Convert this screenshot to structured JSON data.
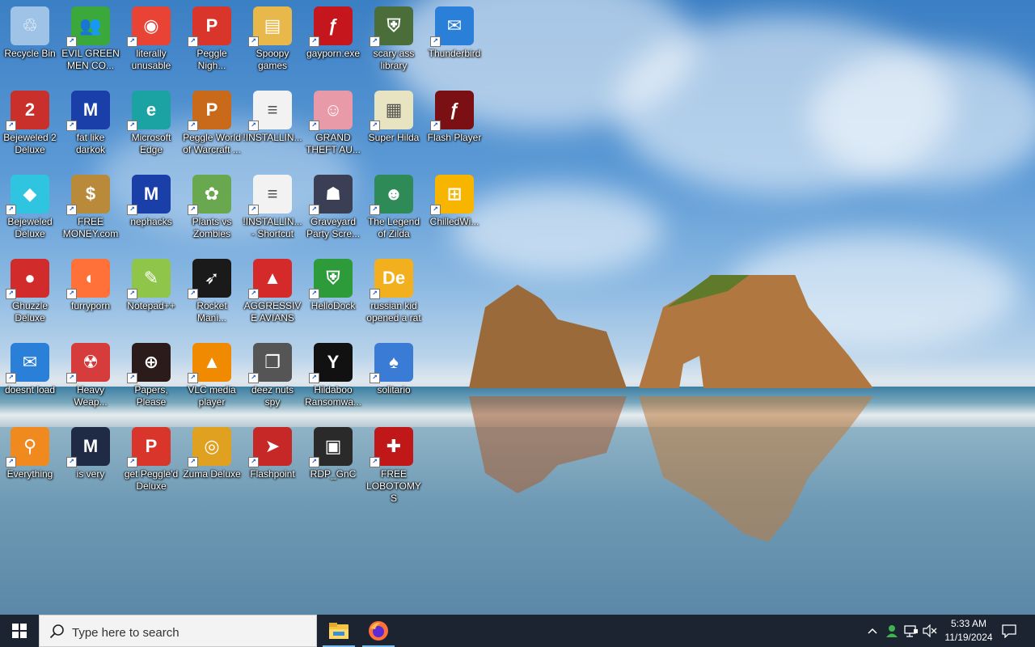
{
  "desktop": {
    "icons": [
      {
        "label": "Recycle Bin",
        "icon": "recycle-bin-icon",
        "color": "#9fc3e6",
        "glyph": "♲"
      },
      {
        "label": "EVIL GREEN MEN CO...",
        "icon": "green-people-icon",
        "color": "#3aa83a",
        "glyph": "👥"
      },
      {
        "label": "literally unusable",
        "icon": "chrome-icon",
        "color": "#e94335",
        "glyph": "◉"
      },
      {
        "label": "Peggle Nigh...",
        "icon": "peggle-icon",
        "color": "#d9352a",
        "glyph": "P"
      },
      {
        "label": "Spoopy games",
        "icon": "folder-icon",
        "color": "#e8b84a",
        "glyph": "▤"
      },
      {
        "label": "gayporn.exe",
        "icon": "flash-icon",
        "color": "#c4161c",
        "glyph": "ƒ"
      },
      {
        "label": "scary ass library",
        "icon": "library-shield-icon",
        "color": "#4a6d3a",
        "glyph": "⛨"
      },
      {
        "label": "Thunderbird",
        "icon": "thunderbird-icon",
        "color": "#2a7fd9",
        "glyph": "✉"
      },
      {
        "label": "Bejeweled 2 Deluxe",
        "icon": "bejeweled2-icon",
        "color": "#c9302c",
        "glyph": "2"
      },
      {
        "label": "fat like darkok",
        "icon": "mpi-icon",
        "color": "#1b3fa8",
        "glyph": "M"
      },
      {
        "label": "Microsoft Edge",
        "icon": "edge-icon",
        "color": "#1ba3a3",
        "glyph": "e"
      },
      {
        "label": "Peggle World of Warcraft ...",
        "icon": "peggle-wow-icon",
        "color": "#c96a1a",
        "glyph": "P"
      },
      {
        "label": "!INSTALLIN...",
        "icon": "text-file-icon",
        "color": "#f2f2f2",
        "glyph": "≡"
      },
      {
        "label": "GRAND THEFT AU...",
        "icon": "anime-girl-icon",
        "color": "#e89aa8",
        "glyph": "☺"
      },
      {
        "label": "Super Hilda",
        "icon": "pixel-hilda-icon",
        "color": "#e8e3c0",
        "glyph": "▦"
      },
      {
        "label": "Flash Player",
        "icon": "flash-player-icon",
        "color": "#7a1013",
        "glyph": "ƒ"
      },
      {
        "label": "Bejeweled Deluxe",
        "icon": "gem-icon",
        "color": "#2fc4e0",
        "glyph": "◆"
      },
      {
        "label": "FREE MONEY.com",
        "icon": "money-bag-icon",
        "color": "#b98a3a",
        "glyph": "$"
      },
      {
        "label": "nephacks",
        "icon": "mpi-icon",
        "color": "#1b3fa8",
        "glyph": "M"
      },
      {
        "label": "Plants vs Zombies",
        "icon": "plants-vs-zombies-icon",
        "color": "#6aa84f",
        "glyph": "✿"
      },
      {
        "label": "!INSTALLIN... - Shortcut",
        "icon": "text-file-icon",
        "color": "#f2f2f2",
        "glyph": "≡"
      },
      {
        "label": "Graveyard Party Scre...",
        "icon": "graveyard-icon",
        "color": "#3a3f55",
        "glyph": "☗"
      },
      {
        "label": "The Legend of Zilda",
        "icon": "zilda-icon",
        "color": "#2e8b57",
        "glyph": "☻"
      },
      {
        "label": "ChilledWi...",
        "icon": "windows-flag-icon",
        "color": "#f7b500",
        "glyph": "⊞"
      },
      {
        "label": "Ghuzzle Deluxe",
        "icon": "red-creature-icon",
        "color": "#d12b2b",
        "glyph": "●"
      },
      {
        "label": "furryporn",
        "icon": "firefox-icon",
        "color": "#ff7139",
        "glyph": "◐"
      },
      {
        "label": "Notepad++",
        "icon": "notepad-plus-icon",
        "color": "#8fc64a",
        "glyph": "✎"
      },
      {
        "label": "Rocket Mani...",
        "icon": "rocket-icon",
        "color": "#1a1a1a",
        "glyph": "➶"
      },
      {
        "label": "AGGRESSIVE AVIANS",
        "icon": "angry-bird-icon",
        "color": "#d42a2a",
        "glyph": "▲"
      },
      {
        "label": "HelloDock",
        "icon": "windows-shield-icon",
        "color": "#2e9b3b",
        "glyph": "⛨"
      },
      {
        "label": "russian kid opened a rat",
        "icon": "de-icon",
        "color": "#f2b01e",
        "glyph": "De"
      },
      {
        "label": "",
        "icon": "",
        "color": "",
        "glyph": ""
      },
      {
        "label": "doesnt load",
        "icon": "thunderbird-icon",
        "color": "#2a7fd9",
        "glyph": "✉"
      },
      {
        "label": "Heavy Weap...",
        "icon": "radiation-icon",
        "color": "#d63c3c",
        "glyph": "☢"
      },
      {
        "label": "Papers, Please",
        "icon": "papers-please-icon",
        "color": "#2b1b1b",
        "glyph": "⊕"
      },
      {
        "label": "VLC media player",
        "icon": "vlc-icon",
        "color": "#f08a00",
        "glyph": "▲"
      },
      {
        "label": "deez nuts spy",
        "icon": "windows-stack-icon",
        "color": "#555555",
        "glyph": "❐"
      },
      {
        "label": "Hildaboo Ransomwa...",
        "icon": "yashma-icon",
        "color": "#111111",
        "glyph": "Y"
      },
      {
        "label": "solitario",
        "icon": "card-icon",
        "color": "#3a7bd5",
        "glyph": "♠"
      },
      {
        "label": "",
        "icon": "",
        "color": "",
        "glyph": ""
      },
      {
        "label": "Everything",
        "icon": "magnifier-icon",
        "color": "#f08a1e",
        "glyph": "⚲"
      },
      {
        "label": "is very",
        "icon": "mpi-shield-icon",
        "color": "#1f2a44",
        "glyph": "M"
      },
      {
        "label": "get Peggle'd Deluxe",
        "icon": "peggle-icon",
        "color": "#d9352a",
        "glyph": "P"
      },
      {
        "label": "Zuma Deluxe",
        "icon": "zuma-icon",
        "color": "#e0a020",
        "glyph": "◎"
      },
      {
        "label": "Flashpoint",
        "icon": "flashpoint-icon",
        "color": "#c62828",
        "glyph": "➤"
      },
      {
        "label": "RDP_GnC",
        "icon": "rdp-icon",
        "color": "#2a2a2a",
        "glyph": "▣"
      },
      {
        "label": "FREE LOBOTOMYS",
        "icon": "lobotomy-icon",
        "color": "#c01818",
        "glyph": "✚"
      },
      {
        "label": "",
        "icon": "",
        "color": "",
        "glyph": ""
      }
    ]
  },
  "taskbar": {
    "search_placeholder": "Type here to search",
    "apps": [
      {
        "name": "file-explorer-icon",
        "active": true
      },
      {
        "name": "firefox-icon",
        "active": true
      }
    ],
    "clock": {
      "time": "5:33 AM",
      "date": "11/19/2024"
    },
    "accent": "#76b9ed"
  }
}
